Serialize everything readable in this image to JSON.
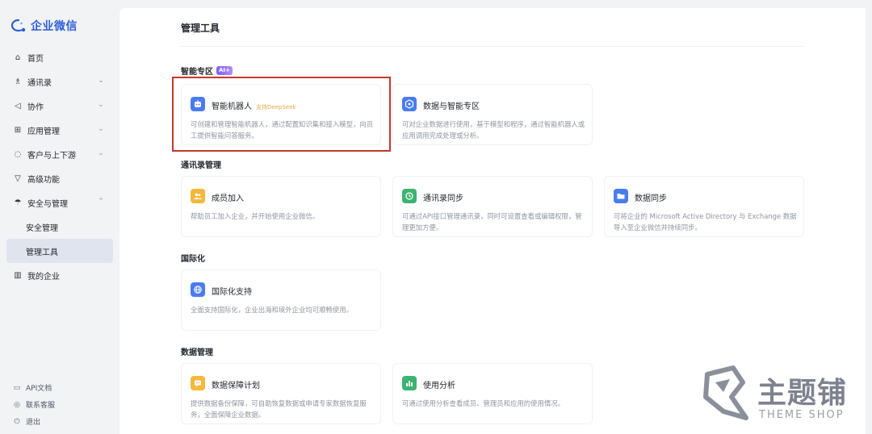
{
  "app": {
    "logo_text": "企业微信",
    "accent": "#2b5fd9"
  },
  "sidebar": {
    "items": [
      {
        "label": "首页",
        "icon": "home-icon",
        "glyph": "⌂",
        "chevron": ""
      },
      {
        "label": "通讯录",
        "icon": "org-tree-icon",
        "glyph": "♗",
        "chevron": "⌄"
      },
      {
        "label": "协作",
        "icon": "collab-icon",
        "glyph": "◁",
        "chevron": "⌄"
      },
      {
        "label": "应用管理",
        "icon": "grid-icon",
        "glyph": "⊞",
        "chevron": "⌄"
      },
      {
        "label": "客户与上下游",
        "icon": "chat-icon",
        "glyph": "◌",
        "chevron": "⌄"
      },
      {
        "label": "高级功能",
        "icon": "advanced-icon",
        "glyph": "▽",
        "chevron": "⌄"
      },
      {
        "label": "安全与管理",
        "icon": "umbrella-icon",
        "glyph": "☂",
        "chevron": "⌃"
      },
      {
        "label": "安全管理",
        "icon": "",
        "glyph": "",
        "chevron": ""
      },
      {
        "label": "管理工具",
        "icon": "",
        "glyph": "",
        "chevron": ""
      },
      {
        "label": "我的企业",
        "icon": "building-icon",
        "glyph": "▥",
        "chevron": ""
      }
    ],
    "bottom": [
      {
        "label": "API文档",
        "icon": "doc-icon",
        "glyph": "▭"
      },
      {
        "label": "联系客服",
        "icon": "headset-icon",
        "glyph": "◎"
      },
      {
        "label": "退出",
        "icon": "power-icon",
        "glyph": "⏻"
      }
    ]
  },
  "main": {
    "title": "管理工具",
    "sections": {
      "ai": {
        "title": "智能专区",
        "badge": "AI+"
      },
      "contacts": {
        "title": "通讯录管理"
      },
      "intl": {
        "title": "国际化"
      },
      "data": {
        "title": "数据管理"
      }
    },
    "cards": {
      "bot": {
        "title": "智能机器人",
        "tag": "支持DeepSeek",
        "desc": "可创建和管理智能机器人，通过配置知识集和接入模型，向员工提供智能问答服务。",
        "icon": "robot-icon",
        "color": "#4a7cf0"
      },
      "data_ai": {
        "title": "数据与智能专区",
        "desc": "可对企业数据进行使用，基于模型和程序，通过智能机器人或应用调用完成处理或分析。",
        "icon": "data-cube-icon",
        "color": "#4a7cf0"
      },
      "join": {
        "title": "成员加入",
        "desc": "帮助员工加入企业，并开始使用企业微信。",
        "icon": "members-icon",
        "color": "#f5b83d"
      },
      "sync": {
        "title": "通讯录同步",
        "desc": "可通过API接口管理通讯录，同时可设置查看或编辑权限，管理更加方便。",
        "icon": "sync-icon",
        "color": "#3cb371"
      },
      "datasync": {
        "title": "数据同步",
        "desc": "可将企业的 Microsoft Active Directory 与 Exchange 数据导入至企业微信并持续同步。",
        "icon": "folder-icon",
        "color": "#4a7cf0"
      },
      "i18n": {
        "title": "国际化支持",
        "desc": "全面支持国际化，企业出海和境外企业均可顺畅使用。",
        "icon": "globe-icon",
        "color": "#4a7cf0"
      },
      "backup": {
        "title": "数据保障计划",
        "desc": "提供数据备份保障，可自助恢复数据或申请专家数据恢复服务，全面保障企业数据。",
        "icon": "shield-chat-icon",
        "color": "#f5b83d"
      },
      "usage": {
        "title": "使用分析",
        "desc": "可通过使用分析查看成员、管理员和应用的使用情况。",
        "icon": "bar-chart-icon",
        "color": "#3cb371"
      }
    }
  },
  "watermark": {
    "text": "主题铺",
    "sub": "THEME SHOP"
  }
}
